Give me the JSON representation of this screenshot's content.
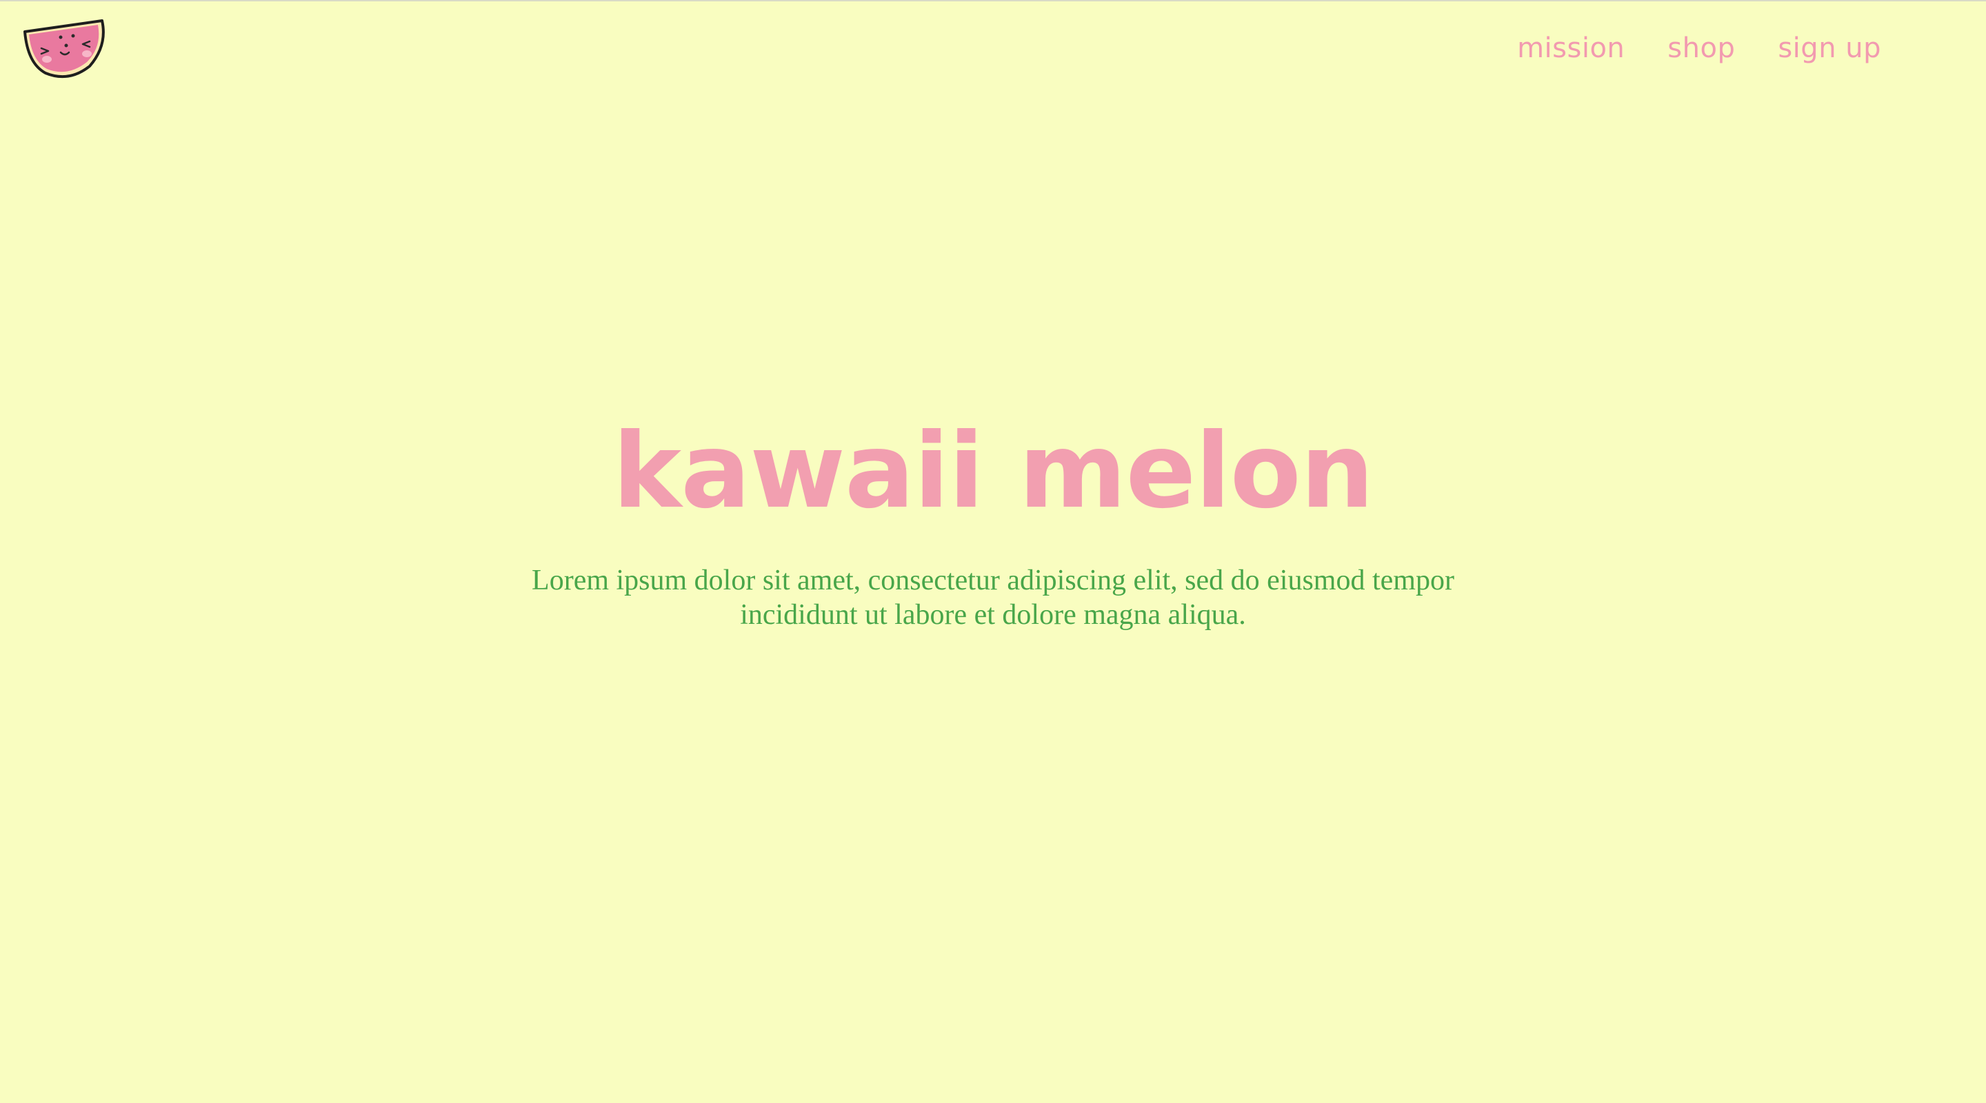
{
  "logo": {
    "icon": "watermelon-face-icon"
  },
  "nav": {
    "items": [
      {
        "label": "mission"
      },
      {
        "label": "shop"
      },
      {
        "label": "sign up"
      }
    ]
  },
  "hero": {
    "title": "kawaii melon",
    "subtitle": "Lorem ipsum dolor sit amet, consectetur adipiscing elit, sed do eiusmod tempor incididunt ut labore et dolore magna aliqua."
  },
  "colors": {
    "background": "#f9fdc0",
    "accent_pink": "#f29fb0",
    "text_green": "#49a64a",
    "melon_flesh": "#e9799f",
    "melon_rind": "#222222"
  }
}
